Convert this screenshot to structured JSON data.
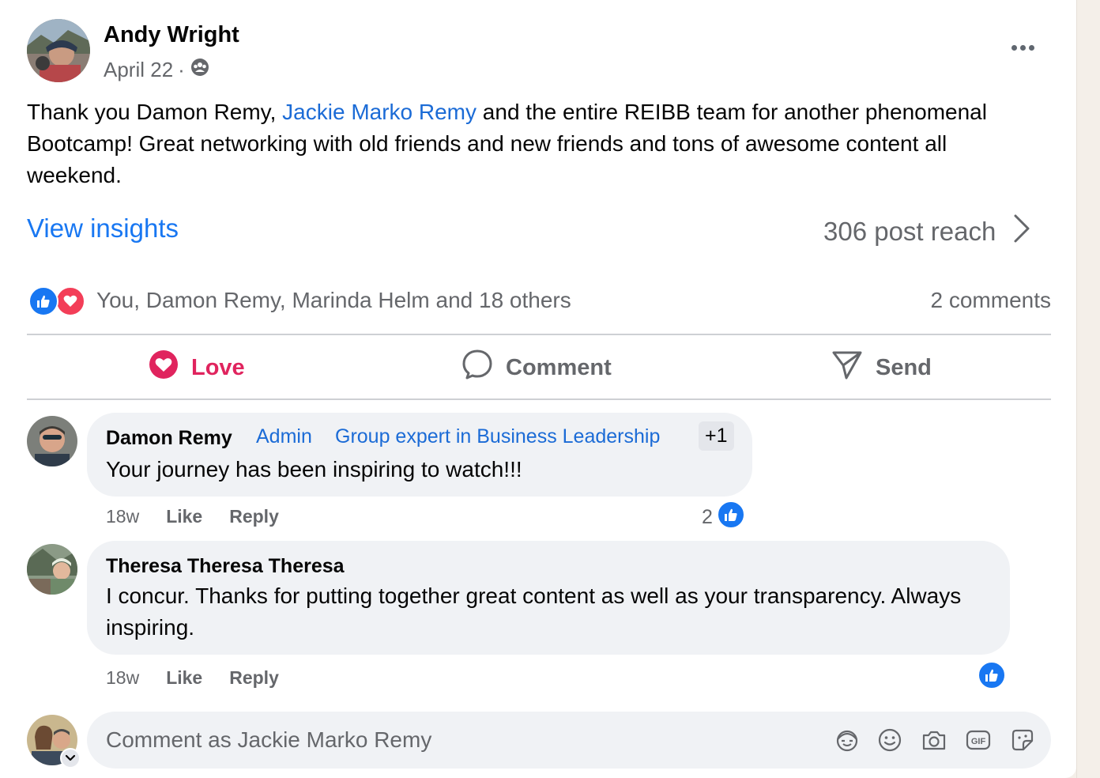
{
  "post": {
    "author": "Andy Wright",
    "date": "April 22",
    "date_sep": "·",
    "text_before": "Thank you Damon Remy, ",
    "mention": "Jackie Marko Remy",
    "text_after": " and the entire REIBB team for another phenomenal Bootcamp!  Great networking with old friends and new friends and tons of awesome content all weekend.",
    "view_insights": "View insights",
    "reach": "306 post reach",
    "reactors": "You, Damon Remy, Marinda Helm and 18 others",
    "comment_count": "2 comments"
  },
  "actions": {
    "love": "Love",
    "comment": "Comment",
    "send": "Send"
  },
  "comments": [
    {
      "name": "Damon Remy",
      "badges": [
        "Admin",
        "Group expert in Business Leadership"
      ],
      "extra_badge": "+1",
      "text": "Your journey has been inspiring to watch!!!",
      "time": "18w",
      "like": "Like",
      "reply": "Reply",
      "reaction_count": "2"
    },
    {
      "name": "Theresa Theresa Theresa",
      "text": "I concur. Thanks for putting together great content as well as your transparency. Always inspiring.",
      "time": "18w",
      "like": "Like",
      "reply": "Reply"
    }
  ],
  "composer": {
    "placeholder": "Comment as Jackie Marko Remy",
    "tools": [
      "avatar-sticker-icon",
      "emoji-icon",
      "camera-icon",
      "gif-icon",
      "sticker-icon"
    ]
  },
  "colors": {
    "link_blue": "#1877f2",
    "mention_blue": "#1b6bd6",
    "love_red": "#e0245e",
    "secondary_text": "#65676b",
    "bubble_bg": "#f0f2f5"
  }
}
